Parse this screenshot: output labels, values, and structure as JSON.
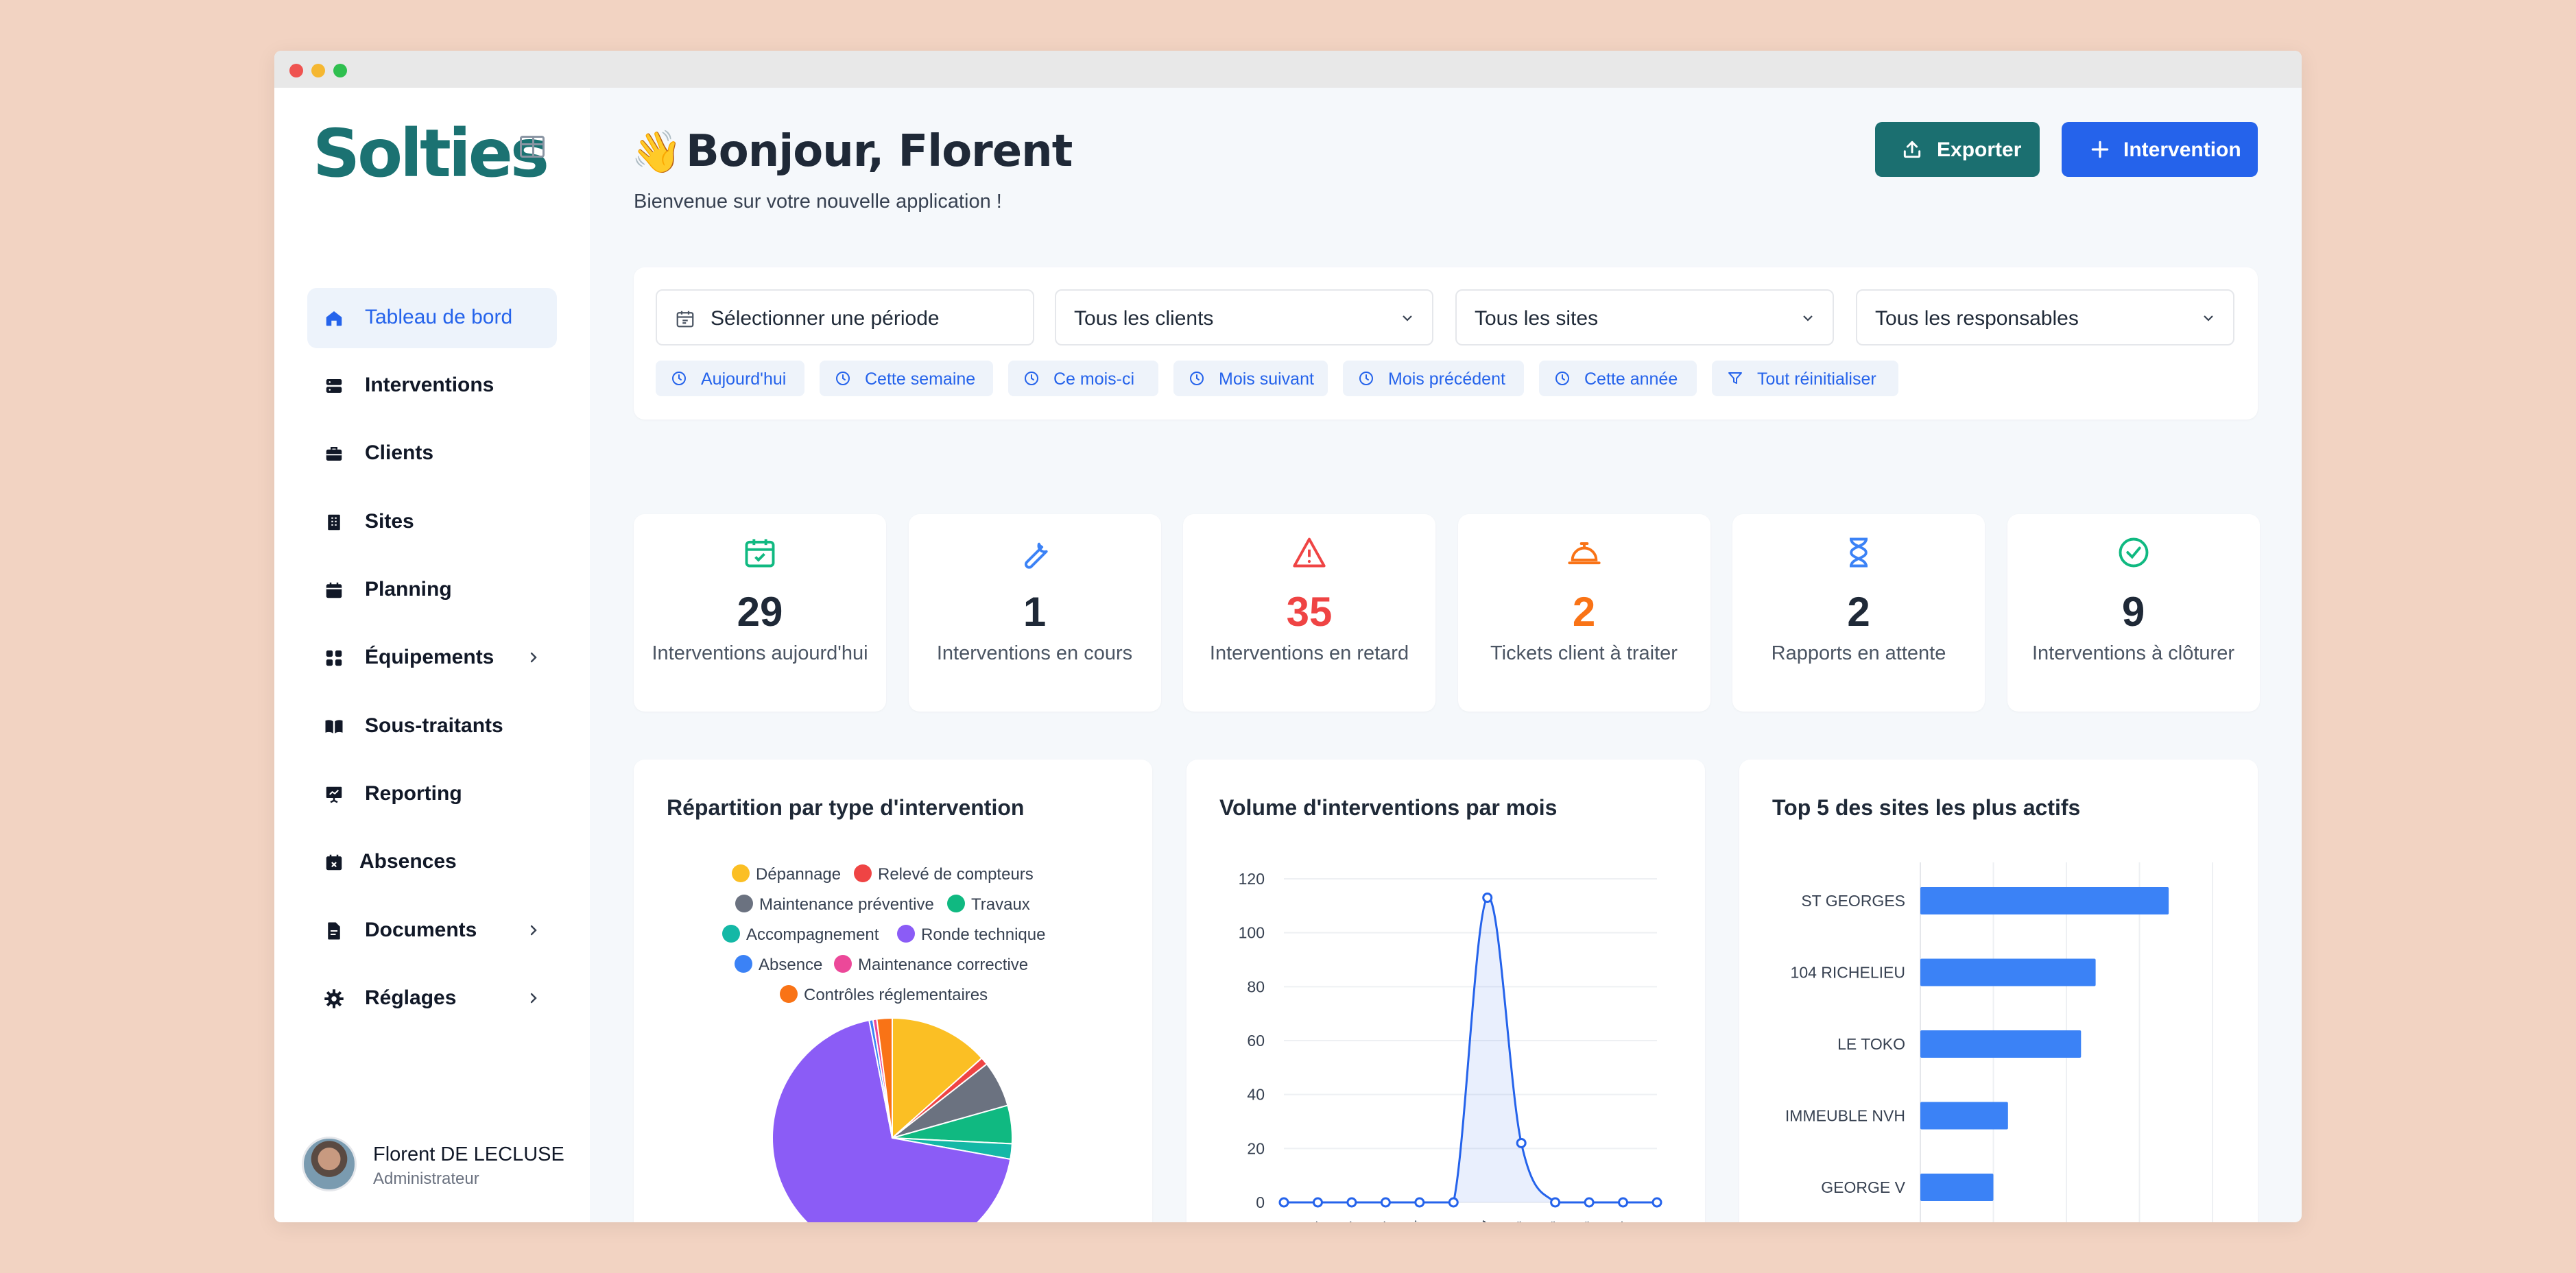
{
  "app": {
    "logo": "Solties"
  },
  "window_dots": [
    "#ef5350",
    "#f5b731",
    "#2fbf4f"
  ],
  "sidebar": {
    "items": [
      {
        "label": "Tableau de bord",
        "icon": "home-icon",
        "active": true
      },
      {
        "label": "Interventions",
        "icon": "server-icon"
      },
      {
        "label": "Clients",
        "icon": "briefcase-icon"
      },
      {
        "label": "Sites",
        "icon": "building-icon"
      },
      {
        "label": "Planning",
        "icon": "calendar-icon"
      },
      {
        "label": "Équipements",
        "icon": "grid-icon",
        "expandable": true
      },
      {
        "label": "Sous-traitants",
        "icon": "book-icon"
      },
      {
        "label": "Reporting",
        "icon": "presentation-icon"
      },
      {
        "label": "Absences",
        "icon": "calendar-x-icon"
      },
      {
        "label": "Documents",
        "icon": "file-icon",
        "expandable": true
      },
      {
        "label": "Réglages",
        "icon": "gear-icon",
        "expandable": true
      }
    ]
  },
  "user": {
    "name": "Florent DE LECLUSE",
    "role": "Administrateur"
  },
  "header": {
    "wave": "👋",
    "title": "Bonjour, Florent",
    "subtitle": "Bienvenue sur votre nouvelle application !",
    "export_label": "Exporter",
    "intervention_label": "Intervention"
  },
  "filters": {
    "period": "Sélectionner une période",
    "clients": "Tous les clients",
    "sites": "Tous les sites",
    "responsables": "Tous les responsables",
    "chips": [
      "Aujourd'hui",
      "Cette semaine",
      "Ce mois-ci",
      "Mois suivant",
      "Mois précédent",
      "Cette année",
      "Tout réinitialiser"
    ]
  },
  "stats": [
    {
      "value": "29",
      "label": "Interventions aujourd'hui",
      "color": "#10b981",
      "icon": "calendar-check-icon",
      "value_color": "#1f2937"
    },
    {
      "value": "1",
      "label": "Interventions en cours",
      "color": "#3b82f6",
      "icon": "wrench-icon",
      "value_color": "#1f2937"
    },
    {
      "value": "35",
      "label": "Interventions en retard",
      "color": "#ef4444",
      "icon": "warning-icon",
      "value_color": "#ef4444"
    },
    {
      "value": "2",
      "label": "Tickets client à traiter",
      "color": "#f97316",
      "icon": "bell-icon",
      "value_color": "#f97316"
    },
    {
      "value": "2",
      "label": "Rapports en attente",
      "color": "#3b82f6",
      "icon": "hourglass-icon",
      "value_color": "#1f2937"
    },
    {
      "value": "9",
      "label": "Interventions à clôturer",
      "color": "#10b981",
      "icon": "check-circle-icon",
      "value_color": "#1f2937"
    }
  ],
  "charts": {
    "pie_title": "Répartition par type d'intervention",
    "line_title": "Volume d'interventions par mois",
    "bar_title": "Top 5 des sites les plus actifs"
  },
  "chart_data": [
    {
      "type": "pie",
      "title": "Répartition par type d'intervention",
      "legend": "top",
      "categories": [
        "Dépannage",
        "Relevé de compteurs",
        "Maintenance préventive",
        "Travaux",
        "Accompagnement",
        "Ronde technique",
        "Absence",
        "Maintenance corrective",
        "Contrôles réglementaires"
      ],
      "values": [
        13,
        1,
        6,
        5,
        2,
        67,
        0.5,
        0.5,
        2
      ],
      "colors": [
        "#fbbf24",
        "#ef4444",
        "#6b7280",
        "#10b981",
        "#14b8a6",
        "#8b5cf6",
        "#3b82f6",
        "#ec4899",
        "#f97316"
      ]
    },
    {
      "type": "area",
      "title": "Volume d'interventions par mois",
      "categories": [
        "Jan",
        "Fév",
        "Mar",
        "Avr",
        "Mai",
        "Juin",
        "Juil",
        "Août",
        "Sept",
        "Oct",
        "Nov",
        "Déc"
      ],
      "values": [
        0,
        0,
        0,
        0,
        0,
        0,
        113,
        22,
        0,
        0,
        0,
        0
      ],
      "yticks": [
        0,
        20,
        40,
        60,
        80,
        100,
        120
      ],
      "ylim": [
        0,
        120
      ],
      "color": "#2563eb",
      "grid": true
    },
    {
      "type": "bar",
      "orientation": "horizontal",
      "title": "Top 5 des sites les plus actifs",
      "categories": [
        "ST GEORGES",
        "104 RICHELIEU",
        "LE TOKO",
        "IMMEUBLE NVH",
        "GEORGE V"
      ],
      "values": [
        17,
        12,
        11,
        6,
        5
      ],
      "xticks": [
        0,
        5,
        10,
        15,
        20
      ],
      "xlim": [
        0,
        20
      ],
      "color": "#3b82f6",
      "grid": true
    }
  ]
}
